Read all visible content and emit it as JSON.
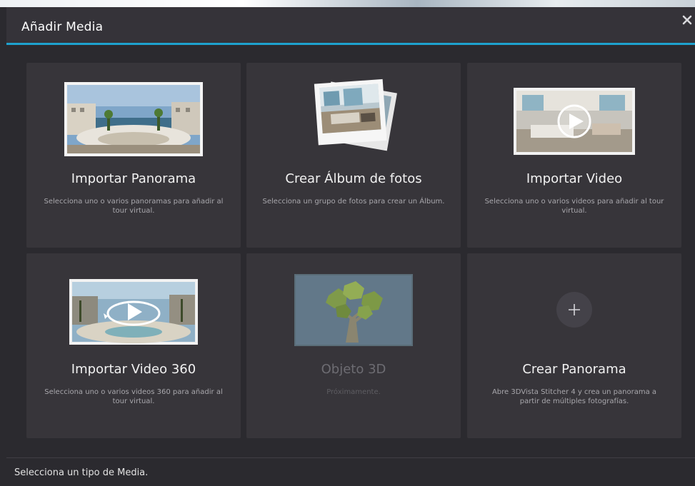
{
  "dialog": {
    "title": "Añadir Media",
    "close_icon": "close-icon",
    "accent_color": "#1ea2cf"
  },
  "cards": [
    {
      "title": "Importar Panorama",
      "desc": "Selecciona uno o varios panoramas para añadir al tour virtual.",
      "icon": "panorama-thumbnail-icon",
      "enabled": true
    },
    {
      "title": "Crear Álbum de fotos",
      "desc": "Selecciona un grupo de fotos para crear un Álbum.",
      "icon": "photo-album-icon",
      "enabled": true
    },
    {
      "title": "Importar Video",
      "desc": "Selecciona uno o varios videos para añadir al tour virtual.",
      "icon": "video-thumbnail-icon",
      "enabled": true
    },
    {
      "title": "Importar Video 360",
      "desc": "Selecciona uno o varios videos 360 para añadir al tour virtual.",
      "icon": "video-360-icon",
      "enabled": true
    },
    {
      "title": "Objeto 3D",
      "desc": "Próximamente.",
      "icon": "3d-object-tree-icon",
      "enabled": false
    },
    {
      "title": "Crear Panorama",
      "desc": "Abre 3DVista Stitcher 4 y crea un panorama a partir de múltiples fotografías.",
      "icon": "plus-icon",
      "enabled": true
    }
  ],
  "status_bar": {
    "text": "Selecciona un tipo de Media."
  }
}
